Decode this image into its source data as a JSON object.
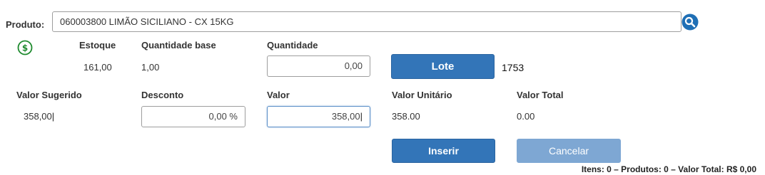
{
  "product": {
    "label": "Produto:",
    "value": "060003800 LIMÃO SICILIANO - CX 15KG"
  },
  "stock": {
    "estoque_label": "Estoque",
    "estoque_value": "161,00",
    "qtd_base_label": "Quantidade base",
    "qtd_base_value": "1,00",
    "quantidade_label": "Quantidade",
    "quantidade_value": "0,00",
    "lote_label": "Lote",
    "lote_value": "1753"
  },
  "pricing": {
    "sugerido_label": "Valor Sugerido",
    "sugerido_value": "358,00",
    "desconto_label": "Desconto",
    "desconto_value": "0,00 %",
    "valor_label": "Valor",
    "valor_value": "358,00",
    "unitario_label": "Valor Unitário",
    "unitario_value": "358.00",
    "total_label": "Valor Total",
    "total_value": "0.00"
  },
  "actions": {
    "inserir_label": "Inserir",
    "cancelar_label": "Cancelar"
  },
  "summary": {
    "text": "Itens: 0 – Produtos: 0 – Valor Total: R$ 0,00"
  },
  "colors": {
    "primary": "#3375b8",
    "disabled": "#7ea7d3",
    "money_icon": "#1e8a2e"
  },
  "icons": {
    "search": "search-icon",
    "money": "dollar-circle-icon"
  }
}
